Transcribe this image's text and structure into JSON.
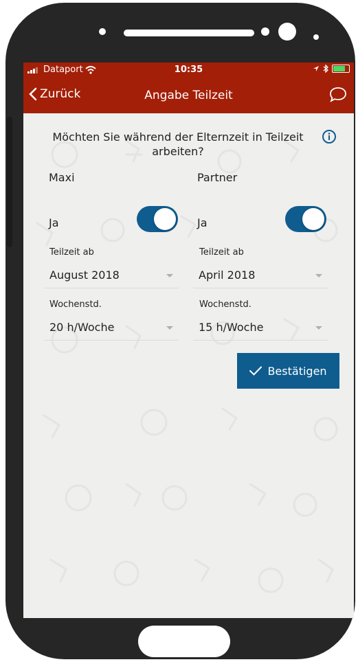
{
  "status_bar": {
    "carrier": "Dataport",
    "time": "10:35"
  },
  "nav": {
    "back_label": "Zurück",
    "title": "Angabe Teilzeit"
  },
  "question": "Möchten Sie während der Elternzeit in Teilzeit arbeiten?",
  "columns": [
    {
      "name": "Maxi",
      "toggle_label": "Ja",
      "toggle_on": true,
      "start_label": "Teilzeit ab",
      "start_value": "August 2018",
      "hours_label": "Wochenstd.",
      "hours_value": "20 h/Woche"
    },
    {
      "name": "Partner",
      "toggle_label": "Ja",
      "toggle_on": true,
      "start_label": "Teilzeit ab",
      "start_value": "April 2018",
      "hours_label": "Wochenstd.",
      "hours_value": "15 h/Woche"
    }
  ],
  "confirm_label": "Bestätigen",
  "colors": {
    "header": "#a31f08",
    "accent": "#0f5c8f",
    "background": "#efefee"
  },
  "icons": [
    "signal-icon",
    "wifi-icon",
    "location-icon",
    "bluetooth-icon",
    "battery-icon",
    "back-chevron-icon",
    "chat-icon",
    "info-icon",
    "check-icon"
  ]
}
